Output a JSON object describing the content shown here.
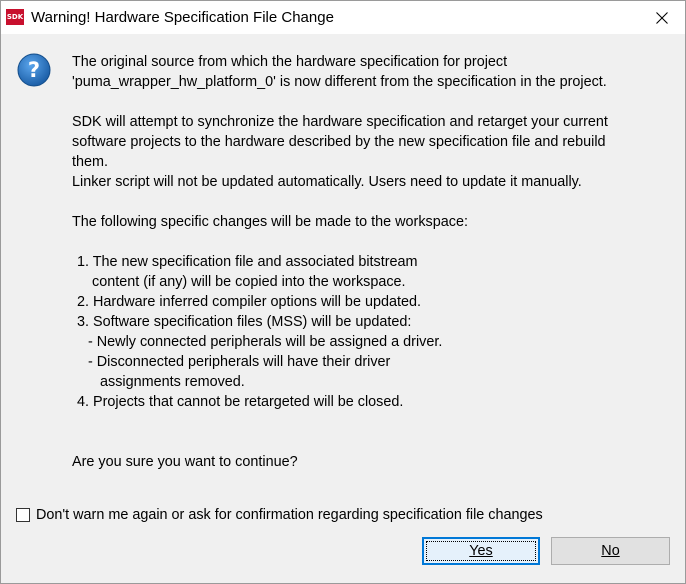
{
  "window": {
    "app_icon_text": "SDK",
    "title": "Warning! Hardware Specification File Change",
    "close_icon": "close-icon"
  },
  "dialog": {
    "icon": "question-icon",
    "message_lines": [
      "The original source from which the hardware specification for project",
      "'puma_wrapper_hw_platform_0' is now different from the specification in the project.",
      "",
      "SDK will attempt to synchronize the hardware specification and retarget your current",
      "software projects to the hardware described by the new specification file and rebuild",
      "them.",
      "Linker script will not be updated automatically. Users need to update it manually.",
      "",
      "The following specific changes will be made to the workspace:",
      "",
      "1. The new specification file and associated bitstream",
      "content (if any) will be copied into the workspace.",
      "2. Hardware inferred compiler options will be updated.",
      "3. Software specification files (MSS) will be updated:",
      "- Newly connected peripherals will be assigned a driver.",
      "- Disconnected peripherals will have their driver",
      "assignments removed.",
      "4. Projects that cannot be retargeted will be closed.",
      "",
      "",
      "Are you sure you want to continue?"
    ],
    "checkbox": {
      "label": "Don't warn me again or ask for confirmation regarding specification file changes",
      "checked": false
    },
    "buttons": {
      "yes": "Yes",
      "no": "No"
    }
  },
  "colors": {
    "title_bar": "#ffffff",
    "dialog_bg": "#f0f0f0",
    "default_button_border": "#0078d7",
    "icon_blue": "#1c6fbf"
  }
}
